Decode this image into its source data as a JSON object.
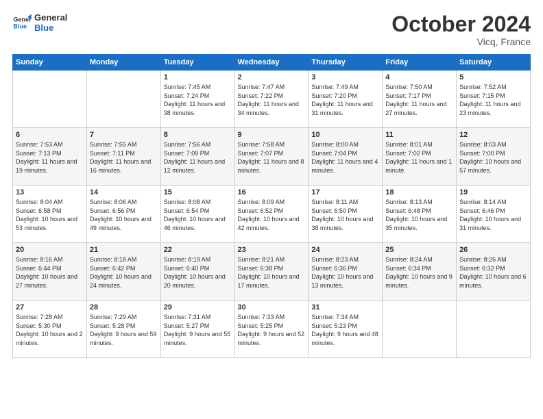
{
  "header": {
    "logo": {
      "line1": "General",
      "line2": "Blue"
    },
    "title": "October 2024",
    "subtitle": "Vicq, France"
  },
  "weekdays": [
    "Sunday",
    "Monday",
    "Tuesday",
    "Wednesday",
    "Thursday",
    "Friday",
    "Saturday"
  ],
  "weeks": [
    [
      {
        "day": "",
        "info": ""
      },
      {
        "day": "",
        "info": ""
      },
      {
        "day": "1",
        "info": "Sunrise: 7:45 AM\nSunset: 7:24 PM\nDaylight: 11 hours and 38 minutes."
      },
      {
        "day": "2",
        "info": "Sunrise: 7:47 AM\nSunset: 7:22 PM\nDaylight: 11 hours and 34 minutes."
      },
      {
        "day": "3",
        "info": "Sunrise: 7:49 AM\nSunset: 7:20 PM\nDaylight: 11 hours and 31 minutes."
      },
      {
        "day": "4",
        "info": "Sunrise: 7:50 AM\nSunset: 7:17 PM\nDaylight: 11 hours and 27 minutes."
      },
      {
        "day": "5",
        "info": "Sunrise: 7:52 AM\nSunset: 7:15 PM\nDaylight: 11 hours and 23 minutes."
      }
    ],
    [
      {
        "day": "6",
        "info": "Sunrise: 7:53 AM\nSunset: 7:13 PM\nDaylight: 11 hours and 19 minutes."
      },
      {
        "day": "7",
        "info": "Sunrise: 7:55 AM\nSunset: 7:11 PM\nDaylight: 11 hours and 16 minutes."
      },
      {
        "day": "8",
        "info": "Sunrise: 7:56 AM\nSunset: 7:09 PM\nDaylight: 11 hours and 12 minutes."
      },
      {
        "day": "9",
        "info": "Sunrise: 7:58 AM\nSunset: 7:07 PM\nDaylight: 11 hours and 8 minutes."
      },
      {
        "day": "10",
        "info": "Sunrise: 8:00 AM\nSunset: 7:04 PM\nDaylight: 11 hours and 4 minutes."
      },
      {
        "day": "11",
        "info": "Sunrise: 8:01 AM\nSunset: 7:02 PM\nDaylight: 11 hours and 1 minute."
      },
      {
        "day": "12",
        "info": "Sunrise: 8:03 AM\nSunset: 7:00 PM\nDaylight: 10 hours and 57 minutes."
      }
    ],
    [
      {
        "day": "13",
        "info": "Sunrise: 8:04 AM\nSunset: 6:58 PM\nDaylight: 10 hours and 53 minutes."
      },
      {
        "day": "14",
        "info": "Sunrise: 8:06 AM\nSunset: 6:56 PM\nDaylight: 10 hours and 49 minutes."
      },
      {
        "day": "15",
        "info": "Sunrise: 8:08 AM\nSunset: 6:54 PM\nDaylight: 10 hours and 46 minutes."
      },
      {
        "day": "16",
        "info": "Sunrise: 8:09 AM\nSunset: 6:52 PM\nDaylight: 10 hours and 42 minutes."
      },
      {
        "day": "17",
        "info": "Sunrise: 8:11 AM\nSunset: 6:50 PM\nDaylight: 10 hours and 38 minutes."
      },
      {
        "day": "18",
        "info": "Sunrise: 8:13 AM\nSunset: 6:48 PM\nDaylight: 10 hours and 35 minutes."
      },
      {
        "day": "19",
        "info": "Sunrise: 8:14 AM\nSunset: 6:46 PM\nDaylight: 10 hours and 31 minutes."
      }
    ],
    [
      {
        "day": "20",
        "info": "Sunrise: 8:16 AM\nSunset: 6:44 PM\nDaylight: 10 hours and 27 minutes."
      },
      {
        "day": "21",
        "info": "Sunrise: 8:18 AM\nSunset: 6:42 PM\nDaylight: 10 hours and 24 minutes."
      },
      {
        "day": "22",
        "info": "Sunrise: 8:19 AM\nSunset: 6:40 PM\nDaylight: 10 hours and 20 minutes."
      },
      {
        "day": "23",
        "info": "Sunrise: 8:21 AM\nSunset: 6:38 PM\nDaylight: 10 hours and 17 minutes."
      },
      {
        "day": "24",
        "info": "Sunrise: 8:23 AM\nSunset: 6:36 PM\nDaylight: 10 hours and 13 minutes."
      },
      {
        "day": "25",
        "info": "Sunrise: 8:24 AM\nSunset: 6:34 PM\nDaylight: 10 hours and 9 minutes."
      },
      {
        "day": "26",
        "info": "Sunrise: 8:26 AM\nSunset: 6:32 PM\nDaylight: 10 hours and 6 minutes."
      }
    ],
    [
      {
        "day": "27",
        "info": "Sunrise: 7:28 AM\nSunset: 5:30 PM\nDaylight: 10 hours and 2 minutes."
      },
      {
        "day": "28",
        "info": "Sunrise: 7:29 AM\nSunset: 5:28 PM\nDaylight: 9 hours and 59 minutes."
      },
      {
        "day": "29",
        "info": "Sunrise: 7:31 AM\nSunset: 5:27 PM\nDaylight: 9 hours and 55 minutes."
      },
      {
        "day": "30",
        "info": "Sunrise: 7:33 AM\nSunset: 5:25 PM\nDaylight: 9 hours and 52 minutes."
      },
      {
        "day": "31",
        "info": "Sunrise: 7:34 AM\nSunset: 5:23 PM\nDaylight: 9 hours and 48 minutes."
      },
      {
        "day": "",
        "info": ""
      },
      {
        "day": "",
        "info": ""
      }
    ]
  ]
}
